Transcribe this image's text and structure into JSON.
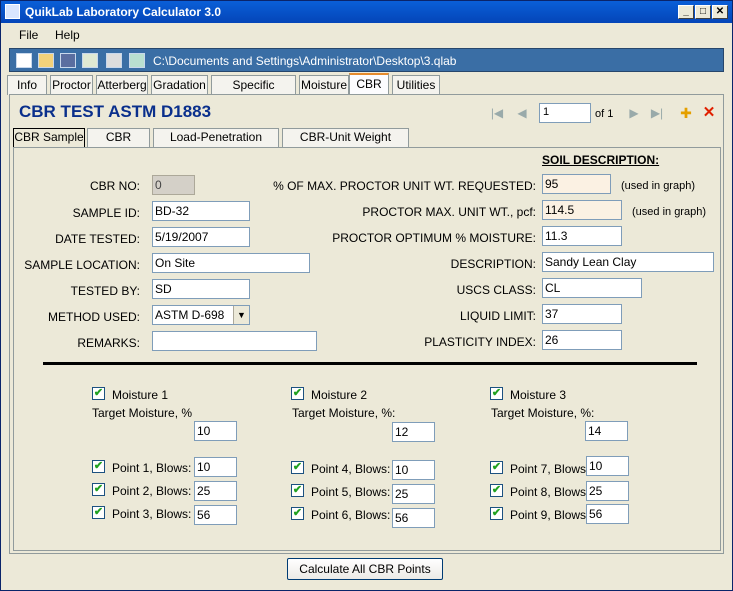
{
  "window": {
    "title": "QuikLab Laboratory Calculator 3.0",
    "min": "_",
    "max": "□",
    "close": "✕"
  },
  "menu": [
    "File",
    "Help"
  ],
  "toolbar": {
    "path": "C:\\Documents and Settings\\Administrator\\Desktop\\3.qlab"
  },
  "tabs": [
    "Info",
    "Proctor",
    "Atterberg",
    "Gradation",
    "Specific Gravitiy",
    "Moisture",
    "CBR",
    "Utilities"
  ],
  "active_tab": "CBR",
  "header": {
    "title": "CBR TEST ASTM D1883",
    "record": "1",
    "of": "of 1"
  },
  "nav": {
    "first": "|◀",
    "prev": "◀",
    "next": "▶",
    "last": "▶|",
    "add": "✚",
    "delete": "✕"
  },
  "subtabs": [
    "CBR Sample",
    "CBR Points",
    "Load-Penetration Curves",
    "CBR-Unit Weight Curves"
  ],
  "left_fields": {
    "cbr_no_label": "CBR NO:",
    "cbr_no": "0",
    "sample_id_label": "SAMPLE ID:",
    "sample_id": "BD-32",
    "date_label": "DATE TESTED:",
    "date": "5/19/2007",
    "location_label": "SAMPLE LOCATION:",
    "location": "On Site",
    "tested_by_label": "TESTED BY:",
    "tested_by": "SD",
    "method_label": "METHOD USED:",
    "method": "ASTM D-698",
    "remarks_label": "REMARKS:",
    "remarks": ""
  },
  "soil_heading": "SOIL DESCRIPTION:",
  "right_fields": {
    "pct_label": "% OF MAX. PROCTOR UNIT WT. REQUESTED:",
    "pct": "95",
    "graph_note": "(used in graph)",
    "max_unit_label": "PROCTOR MAX. UNIT WT., pcf:",
    "max_unit": "114.5",
    "opt_label": "PROCTOR OPTIMUM % MOISTURE:",
    "opt": "11.3",
    "desc_label": "DESCRIPTION:",
    "desc": "Sandy Lean Clay",
    "uscs_label": "USCS CLASS:",
    "uscs": "CL",
    "ll_label": "LIQUID LIMIT:",
    "ll": "37",
    "pi_label": "PLASTICITY INDEX:",
    "pi": "26"
  },
  "moistures": [
    {
      "label": "Moisture 1",
      "target_label": "Target Moisture, %",
      "target": "10"
    },
    {
      "label": "Moisture 2",
      "target_label": "Target Moisture, %:",
      "target": "12"
    },
    {
      "label": "Moisture 3",
      "target_label": "Target Moisture, %:",
      "target": "14"
    }
  ],
  "points": [
    {
      "label": "Point 1, Blows:",
      "blows": "10"
    },
    {
      "label": "Point 2, Blows:",
      "blows": "25"
    },
    {
      "label": "Point 3, Blows:",
      "blows": "56"
    },
    {
      "label": "Point 4, Blows:",
      "blows": "10"
    },
    {
      "label": "Point 5, Blows:",
      "blows": "25"
    },
    {
      "label": "Point 6, Blows:",
      "blows": "56"
    },
    {
      "label": "Point 7, Blows:",
      "blows": "10"
    },
    {
      "label": "Point 8, Blows:",
      "blows": "25"
    },
    {
      "label": "Point 9, Blows:",
      "blows": "56"
    }
  ],
  "check_mark": "✔",
  "calc_button": "Calculate All CBR Points"
}
